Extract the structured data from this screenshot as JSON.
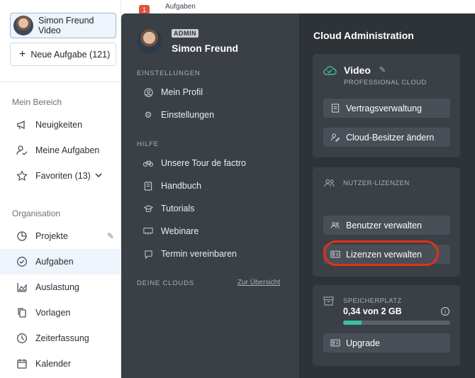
{
  "sidebar": {
    "user": {
      "name": "Simon Freund",
      "cloud": "Video"
    },
    "new_task": "Neue Aufgabe (121)",
    "section_personal": "Mein Bereich",
    "personal_items": [
      {
        "label": "Neuigkeiten",
        "icon": "megaphone-icon"
      },
      {
        "label": "Meine Aufgaben",
        "icon": "user-check-icon"
      },
      {
        "label": "Favoriten (13)",
        "icon": "star-icon"
      }
    ],
    "section_org": "Organisation",
    "org_items": [
      {
        "label": "Projekte",
        "icon": "pie-chart-icon"
      },
      {
        "label": "Aufgaben",
        "icon": "check-circle-icon"
      },
      {
        "label": "Auslastung",
        "icon": "area-chart-icon"
      },
      {
        "label": "Vorlagen",
        "icon": "copy-icon"
      },
      {
        "label": "Zeiterfassung",
        "icon": "clock-icon"
      },
      {
        "label": "Kalender",
        "icon": "calendar-icon"
      }
    ]
  },
  "topbar": {
    "badge": "1",
    "label": "Aufgaben"
  },
  "user_menu": {
    "role_badge": "ADMIN",
    "name": "Simon Freund",
    "settings_heading": "EINSTELLUNGEN",
    "settings_items": [
      {
        "label": "Mein Profil",
        "icon": "user-circle-icon"
      },
      {
        "label": "Einstellungen",
        "icon": "gear-icon"
      }
    ],
    "help_heading": "HILFE",
    "help_items": [
      {
        "label": "Unsere Tour de factro",
        "icon": "bicycle-icon"
      },
      {
        "label": "Handbuch",
        "icon": "book-icon"
      },
      {
        "label": "Tutorials",
        "icon": "graduation-icon"
      },
      {
        "label": "Webinare",
        "icon": "presentation-icon"
      },
      {
        "label": "Termin vereinbaren",
        "icon": "chat-icon"
      }
    ],
    "clouds_heading": "DEINE CLOUDS",
    "clouds_link": "Zur Übersicht"
  },
  "cloud_admin": {
    "title": "Cloud Administration",
    "cloud_name": "Video",
    "cloud_plan": "PROFESSIONAL CLOUD",
    "contract_button": "Vertragsverwaltung",
    "owner_button": "Cloud-Besitzer ändern",
    "licenses_heading": "NUTZER-LIZENZEN",
    "users_button": "Benutzer verwalten",
    "licenses_button": "Lizenzen verwalten",
    "storage_heading": "SPEICHERPLATZ",
    "storage_value": "0,34 von 2 GB",
    "storage_fraction": 0.17,
    "upgrade_button": "Upgrade",
    "accent_color": "#3bbfa2",
    "highlight_color": "#e2301c"
  }
}
